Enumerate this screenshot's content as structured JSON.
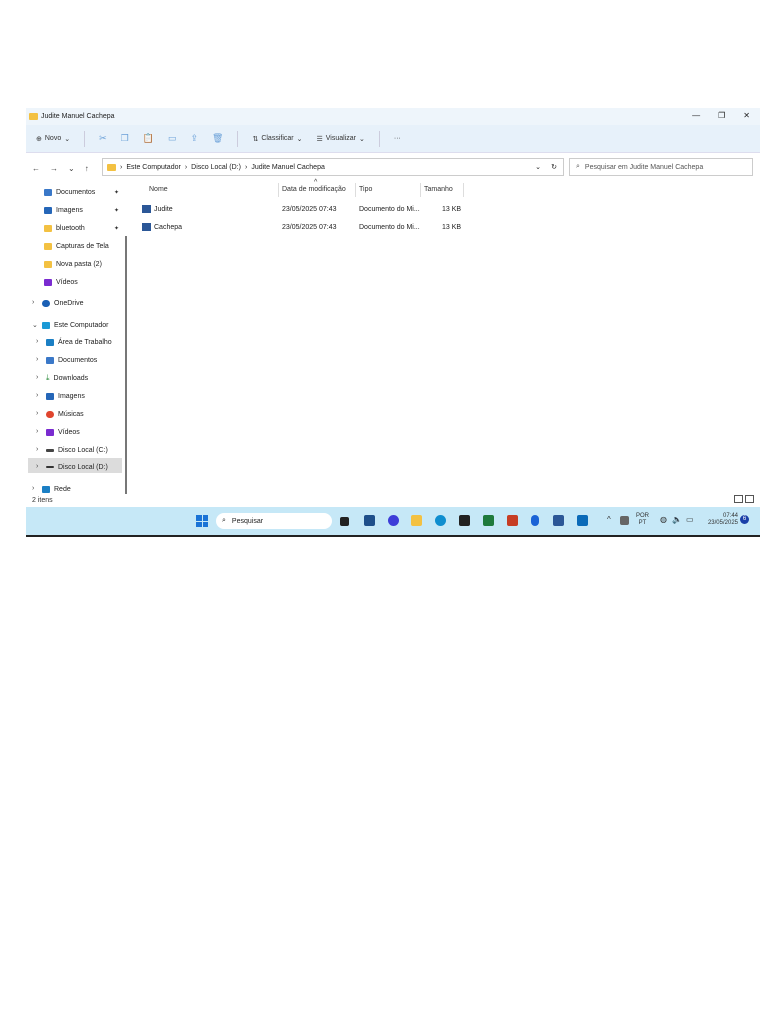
{
  "window": {
    "title": "Judite Manuel Cachepa",
    "minimize": "—",
    "restore": "❐",
    "close": "✕"
  },
  "toolbar": {
    "new": "Novo",
    "new_chev": "⌄",
    "sort": "Classificar",
    "sort_chev": "⌄",
    "view": "Visualizar",
    "view_chev": "⌄",
    "more": "···"
  },
  "address": {
    "back": "←",
    "forward": "→",
    "recent": "⌄",
    "up": "↑",
    "crumbs": [
      "Este Computador",
      "Disco Local (D:)",
      "Judite Manuel Cachepa"
    ],
    "sep": "›",
    "dropdown": "⌄",
    "refresh": "↻",
    "search_placeholder": "Pesquisar em Judite Manuel Cachepa"
  },
  "sidebar": {
    "quick": [
      {
        "label": "Documentos",
        "pinned": true
      },
      {
        "label": "Imagens",
        "pinned": true
      },
      {
        "label": "bluetooth",
        "pinned": true
      },
      {
        "label": "Capturas de Tela"
      },
      {
        "label": "Nova pasta (2)"
      },
      {
        "label": "Vídeos"
      }
    ],
    "onedrive": "OneDrive",
    "this_pc": "Este Computador",
    "pc_items": [
      "Área de Trabalho",
      "Documentos",
      "Downloads",
      "Imagens",
      "Músicas",
      "Vídeos",
      "Disco Local (C:)",
      "Disco Local (D:)"
    ],
    "network": "Rede",
    "pin_glyph": "📌",
    "chev": "›",
    "chev_open": "⌄"
  },
  "columns": {
    "name": "Nome",
    "date": "Data de modificação",
    "type": "Tipo",
    "size": "Tamanho",
    "sort_glyph": "^"
  },
  "files": [
    {
      "name": "Judite",
      "date": "23/05/2025 07:43",
      "type": "Documento do Mi...",
      "size": "13 KB"
    },
    {
      "name": "Cachepa",
      "date": "23/05/2025 07:43",
      "type": "Documento do Mi...",
      "size": "13 KB"
    }
  ],
  "status": {
    "count": "2 itens"
  },
  "taskbar": {
    "search": "Pesquisar",
    "lang1": "POR",
    "lang2": "PT",
    "time": "07:44",
    "date": "23/05/2025",
    "notif": "6",
    "tray_up": "^"
  },
  "colors": {
    "accent": "#1a73d6",
    "taskbar": "#c6e8f7",
    "toolbar": "#e7f1fa"
  }
}
